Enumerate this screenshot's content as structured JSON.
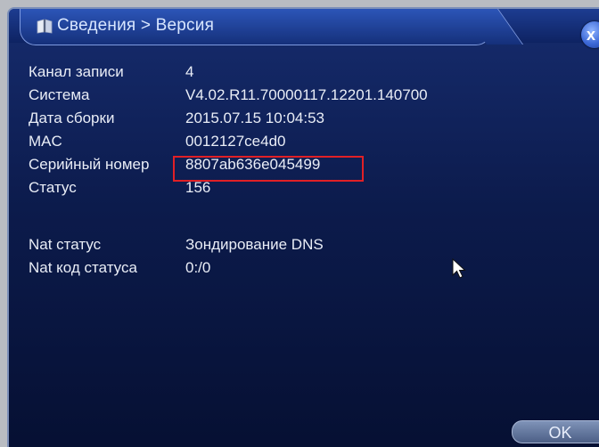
{
  "window": {
    "breadcrumb": "Сведения > Версия",
    "close_label": "x"
  },
  "info": [
    {
      "label": "Канал записи",
      "value": "4"
    },
    {
      "label": "Система",
      "value": "V4.02.R11.70000117.12201.140700"
    },
    {
      "label": "Дата сборки",
      "value": "2015.07.15 10:04:53"
    },
    {
      "label": "MAC",
      "value": "0012127ce4d0"
    },
    {
      "label": "Серийный номер",
      "value": "8807ab636e045499"
    },
    {
      "label": "Статус",
      "value": "156"
    }
  ],
  "nat": [
    {
      "label": "Nat статус",
      "value": "Зондирование DNS"
    },
    {
      "label": "Nat код статуса",
      "value": "0:/0"
    }
  ],
  "buttons": {
    "ok_label": "OK"
  },
  "colors": {
    "window_bg": "#0c1b4c",
    "highlight_border": "#e02026",
    "text": "#e9edf6"
  },
  "icons": {
    "title_icon": "info-book-icon",
    "pointer": "mouse-cursor-icon"
  }
}
